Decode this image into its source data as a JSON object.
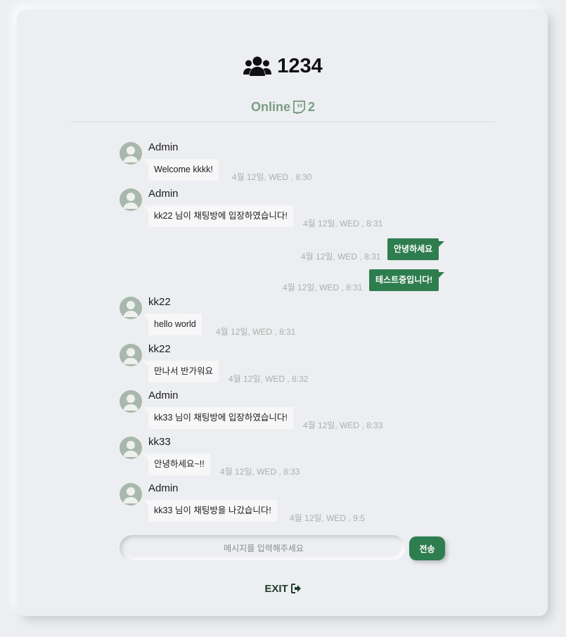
{
  "room": {
    "title": "1234"
  },
  "online": {
    "label": "Online",
    "count": "2"
  },
  "messages": [
    {
      "sender": "Admin",
      "text": "Welcome kkkk!",
      "time": "4월 12일, WED , 8:30"
    },
    {
      "sender": "Admin",
      "text": "kk22 님이 채팅방에 입장하였습니다!",
      "time": "4월 12일, WED , 8:31"
    },
    {
      "text": "안녕하세요",
      "time": "4월 12일, WED , 8:31"
    },
    {
      "text": "테스트중입니다!",
      "time": "4월 12일, WED , 8:31"
    },
    {
      "sender": "kk22",
      "text": "hello world",
      "time": "4월 12일, WED , 8:31"
    },
    {
      "sender": "kk22",
      "text": "만나서 반가워요",
      "time": "4월 12일, WED , 8:32"
    },
    {
      "sender": "Admin",
      "text": "kk33 님이 채팅방에 입장하였습니다!",
      "time": "4월 12일, WED , 8:33"
    },
    {
      "sender": "kk33",
      "text": "안녕하세요~!!",
      "time": "4월 12일, WED , 8:33"
    },
    {
      "sender": "Admin",
      "text": "kk33 님이 채팅방을 나갔습니다!",
      "time": "4월 12일, WED , 9:5"
    }
  ],
  "composer": {
    "placeholder": "메시지를 입력해주세요",
    "send_label": "전송"
  },
  "exit": {
    "label": "EXIT"
  },
  "colors": {
    "accent": "#2e7d4f",
    "online": "#7a9e84",
    "background": "#eceef1"
  }
}
